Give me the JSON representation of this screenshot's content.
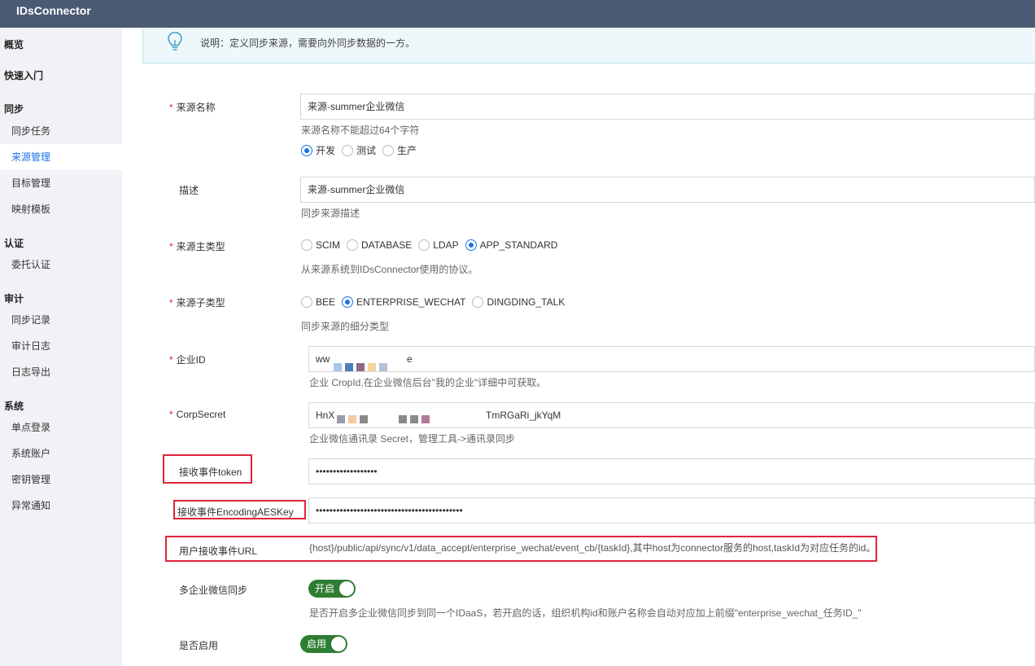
{
  "app": {
    "title": "IDsConnector"
  },
  "sidebar": {
    "overview": "概览",
    "quickstart": "快速入门",
    "groups": [
      {
        "title": "同步",
        "items": [
          "同步任务",
          "来源管理",
          "目标管理",
          "映射模板"
        ]
      },
      {
        "title": "认证",
        "items": [
          "委托认证"
        ]
      },
      {
        "title": "审计",
        "items": [
          "同步记录",
          "审计日志",
          "日志导出"
        ]
      },
      {
        "title": "系统",
        "items": [
          "单点登录",
          "系统账户",
          "密钥管理",
          "异常通知"
        ]
      }
    ],
    "active": "来源管理"
  },
  "notice": {
    "text": "说明：定义同步来源，需要向外同步数据的一方。"
  },
  "form": {
    "source_name": {
      "label": "来源名称",
      "value": "来源-summer企业微信",
      "hint": "来源名称不能超过64个字符"
    },
    "env": {
      "options": [
        "开发",
        "测试",
        "生产"
      ],
      "selected": "开发"
    },
    "description": {
      "label": "描述",
      "value": "来源-summer企业微信",
      "hint": "同步来源描述"
    },
    "main_type": {
      "label": "来源主类型",
      "options": [
        "SCIM",
        "DATABASE",
        "LDAP",
        "APP_STANDARD"
      ],
      "selected": "APP_STANDARD",
      "hint": "从来源系统到IDsConnector使用的协议。"
    },
    "sub_type": {
      "label": "来源子类型",
      "options": [
        "BEE",
        "ENTERPRISE_WECHAT",
        "DINGDING_TALK"
      ],
      "selected": "ENTERPRISE_WECHAT",
      "hint": "同步来源的细分类型"
    },
    "corp_id": {
      "label": "企业ID",
      "value_prefix": "ww",
      "value_suffix": "e",
      "hint": "企业 CropId,在企业微信后台\"我的企业\"详细中可获取。"
    },
    "corp_secret": {
      "label": "CorpSecret",
      "value_prefix": "HnX",
      "value_suffix": "TmRGaRi_jkYqM",
      "hint": "企业微信通讯录 Secret，管理工具->通讯录同步"
    },
    "token": {
      "label": "接收事件token",
      "value": "••••••••••••••••••"
    },
    "aes_key": {
      "label": "接收事件EncodingAESKey",
      "value": "•••••••••••••••••••••••••••••••••••••••••••"
    },
    "event_url": {
      "label": "用户接收事件URL",
      "value": "{host}/public/api/sync/v1/data_accept/enterprise_wechat/event_cb/{taskId},其中host为connector服务的host,taskId为对应任务的id。"
    },
    "multi_corp": {
      "label": "多企业微信同步",
      "switch_text": "开启",
      "hint": "是否开启多企业微信同步到同一个IDaaS，若开启的话，组织机构id和账户名称会自动对应加上前缀\"enterprise_wechat_任务ID_\""
    },
    "enabled": {
      "label": "是否启用",
      "switch_text": "启用"
    }
  },
  "colors": {
    "accent": "#1a73e8",
    "required": "#e0243c",
    "switch_on": "#2e7d32",
    "topbar": "#4a5a72"
  }
}
